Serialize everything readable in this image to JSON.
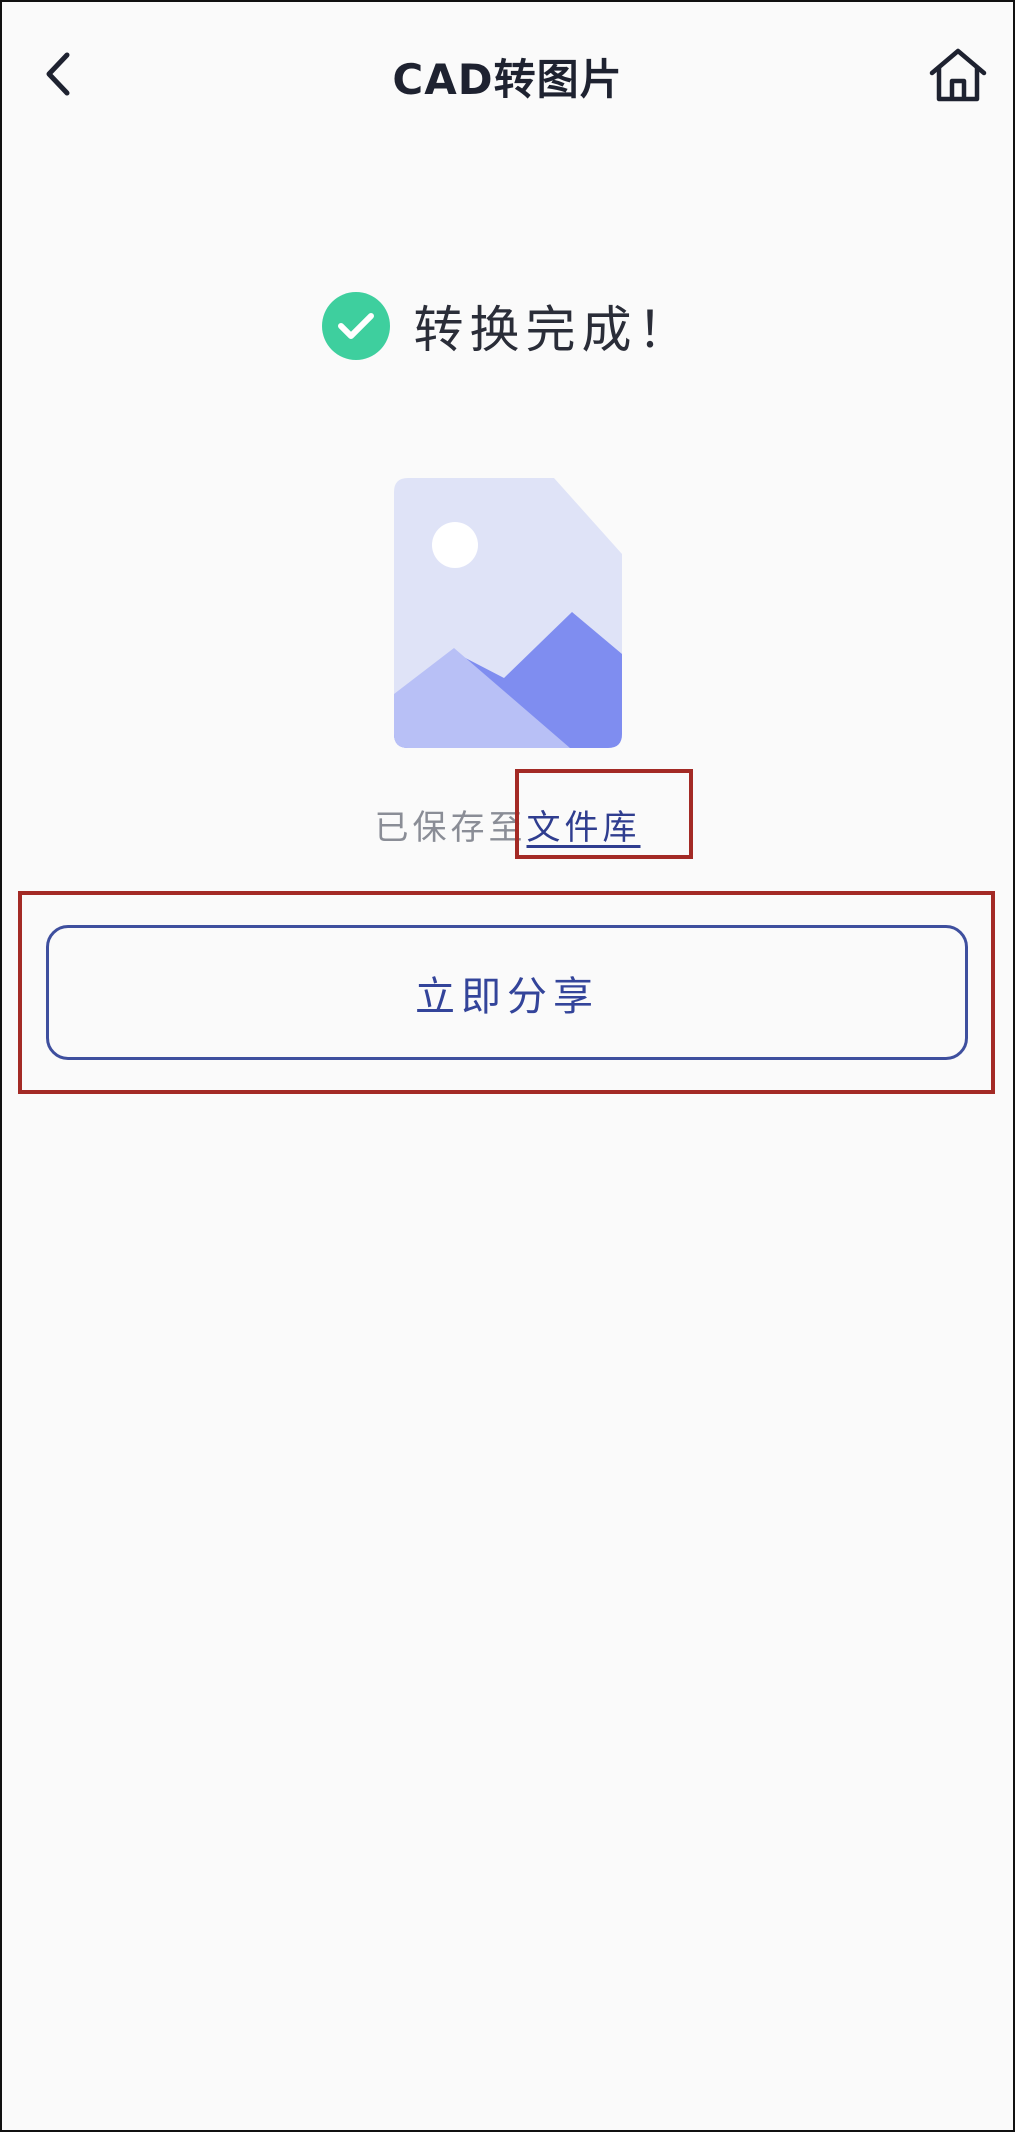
{
  "header": {
    "title": "CAD转图片",
    "back_icon": "chevron-left-icon",
    "home_icon": "home-icon"
  },
  "result": {
    "status_icon": "check-circle-icon",
    "status_text": "转换完成！",
    "thumbnail_icon": "image-file-icon"
  },
  "saved": {
    "prefix": "已保存至",
    "link_label": "文件库"
  },
  "actions": {
    "share_label": "立即分享"
  },
  "colors": {
    "success": "#3ecf9e",
    "accent": "#33449a",
    "highlight": "#a32a25"
  }
}
